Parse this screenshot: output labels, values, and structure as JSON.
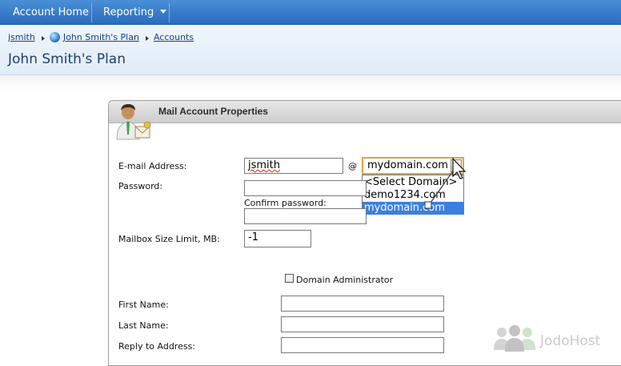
{
  "nav": {
    "account_home": "Account Home",
    "reporting": "Reporting"
  },
  "breadcrumb": {
    "user": "jsmith",
    "plan": "John Smith's Plan",
    "accounts": "Accounts"
  },
  "page_title": "John Smith's Plan",
  "panel": {
    "title": "Mail Account Properties"
  },
  "form": {
    "email_label": "E-mail Address:",
    "email_value": "jsmith",
    "at_sign": "@",
    "domain_selected": "mydomain.com",
    "domain_options": [
      "<Select Domain>",
      "demo1234.com",
      "mydomain.com"
    ],
    "password_label": "Password:",
    "password_value": "",
    "confirm_label": "Confirm password:",
    "confirm_value": "",
    "mailbox_label": "Mailbox Size Limit, MB:",
    "mailbox_value": "-1",
    "domain_admin_label": "Domain Administrator",
    "first_name_label": "First Name:",
    "first_name_value": "",
    "last_name_label": "Last Name:",
    "last_name_value": "",
    "reply_label": "Reply to Address:",
    "reply_value": ""
  },
  "watermark": "JodoHost",
  "colors": {
    "nav_bg": "#2a6cc0",
    "title": "#1b3f73",
    "link": "#1a3f8c",
    "selected_option": "#3b7fe0",
    "select_border": "#d8a64a"
  }
}
